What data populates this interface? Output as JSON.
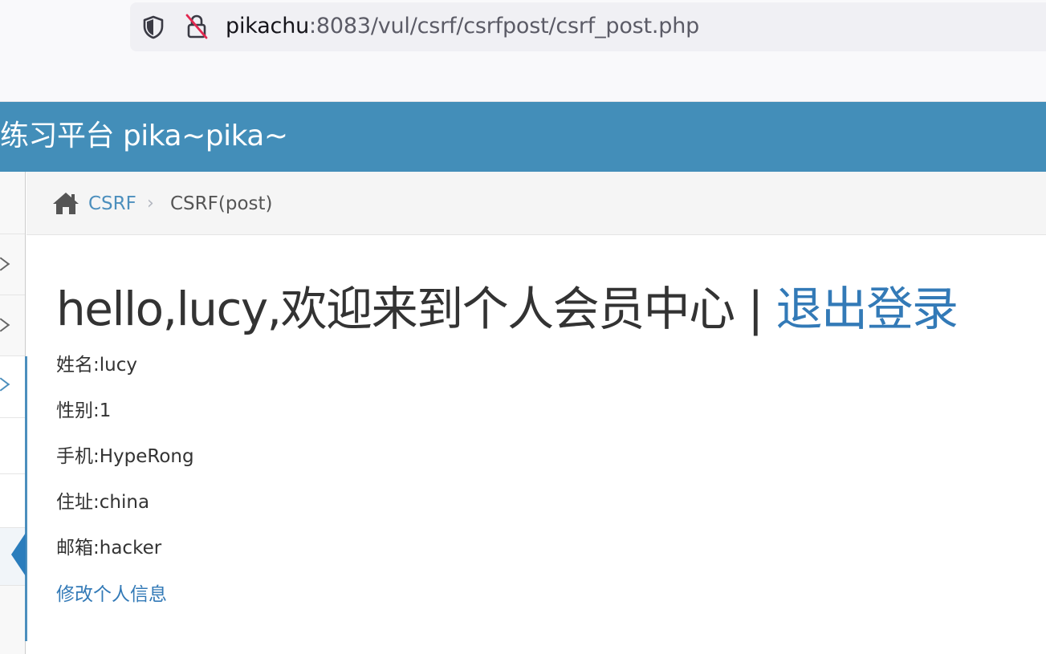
{
  "browser": {
    "url_host": "pikachu",
    "url_rest": ":8083/vul/csrf/csrfpost/csrf_post.php",
    "icons": [
      "shield-icon",
      "insecure-lock-icon"
    ]
  },
  "header": {
    "title": "练习平台 pika~pika~",
    "background_color": "#438eb9"
  },
  "breadcrumb": {
    "home_icon": "home-icon",
    "parent_label": "CSRF",
    "separator": "›",
    "current_label": "CSRF(post)"
  },
  "main": {
    "welcome_text": "hello,lucy,欢迎来到个人会员中心",
    "divider": " | ",
    "logout_label": "退出登录",
    "fields": [
      {
        "label": "姓名:",
        "value": "lucy"
      },
      {
        "label": "性别:",
        "value": "1"
      },
      {
        "label": "手机:",
        "value": "HypeRong"
      },
      {
        "label": "住址:",
        "value": "china"
      },
      {
        "label": "邮箱:",
        "value": "hacker"
      }
    ],
    "edit_link_label": "修改个人信息",
    "link_color": "#337ab7"
  }
}
